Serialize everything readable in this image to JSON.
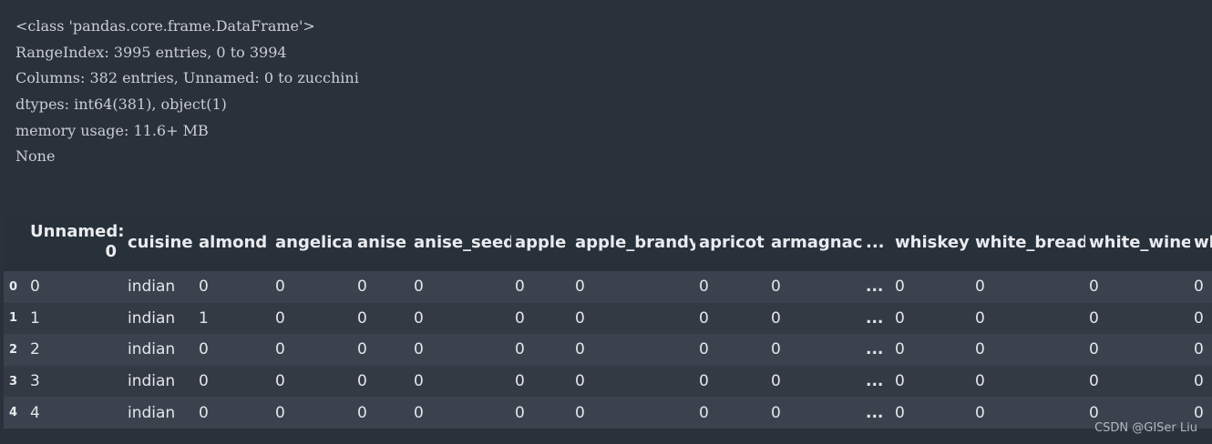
{
  "info_lines": [
    "<class 'pandas.core.frame.DataFrame'>",
    "RangeIndex: 3995 entries, 0 to 3994",
    "Columns: 382 entries, Unnamed: 0 to zucchini",
    "dtypes: int64(381), object(1)",
    "memory usage: 11.6+ MB",
    "None"
  ],
  "table": {
    "columns": [
      "Unnamed: 0",
      "cuisine",
      "almond",
      "angelica",
      "anise",
      "anise_seed",
      "apple",
      "apple_brandy",
      "apricot",
      "armagnac",
      "...",
      "whiskey",
      "white_bread",
      "white_wine",
      "whole_grain_wheat_flour"
    ],
    "column_display": [
      "Unnamed:",
      "0",
      "cuisine",
      "almond",
      "angelica",
      "anise",
      "anise_seed",
      "apple",
      "apple_brandy",
      "apricot",
      "armagnac",
      "...",
      "whiskey",
      "white_bread",
      "white_wine",
      "wh"
    ],
    "rows": [
      {
        "index": "0",
        "cells": [
          "0",
          "indian",
          "0",
          "0",
          "0",
          "0",
          "0",
          "0",
          "0",
          "0",
          "...",
          "0",
          "0",
          "0",
          "0"
        ]
      },
      {
        "index": "1",
        "cells": [
          "1",
          "indian",
          "1",
          "0",
          "0",
          "0",
          "0",
          "0",
          "0",
          "0",
          "...",
          "0",
          "0",
          "0",
          "0"
        ]
      },
      {
        "index": "2",
        "cells": [
          "2",
          "indian",
          "0",
          "0",
          "0",
          "0",
          "0",
          "0",
          "0",
          "0",
          "...",
          "0",
          "0",
          "0",
          "0"
        ]
      },
      {
        "index": "3",
        "cells": [
          "3",
          "indian",
          "0",
          "0",
          "0",
          "0",
          "0",
          "0",
          "0",
          "0",
          "...",
          "0",
          "0",
          "0",
          "0"
        ]
      },
      {
        "index": "4",
        "cells": [
          "4",
          "indian",
          "0",
          "0",
          "0",
          "0",
          "0",
          "0",
          "0",
          "0",
          "...",
          "0",
          "0",
          "0",
          "0"
        ]
      }
    ]
  },
  "watermark": "CSDN @GISer Liu",
  "colors": {
    "background": "#2b313a",
    "header_row": "#283039",
    "row_odd": "#3a424d",
    "row_even": "#333a44",
    "text": "#e3e6ea"
  }
}
